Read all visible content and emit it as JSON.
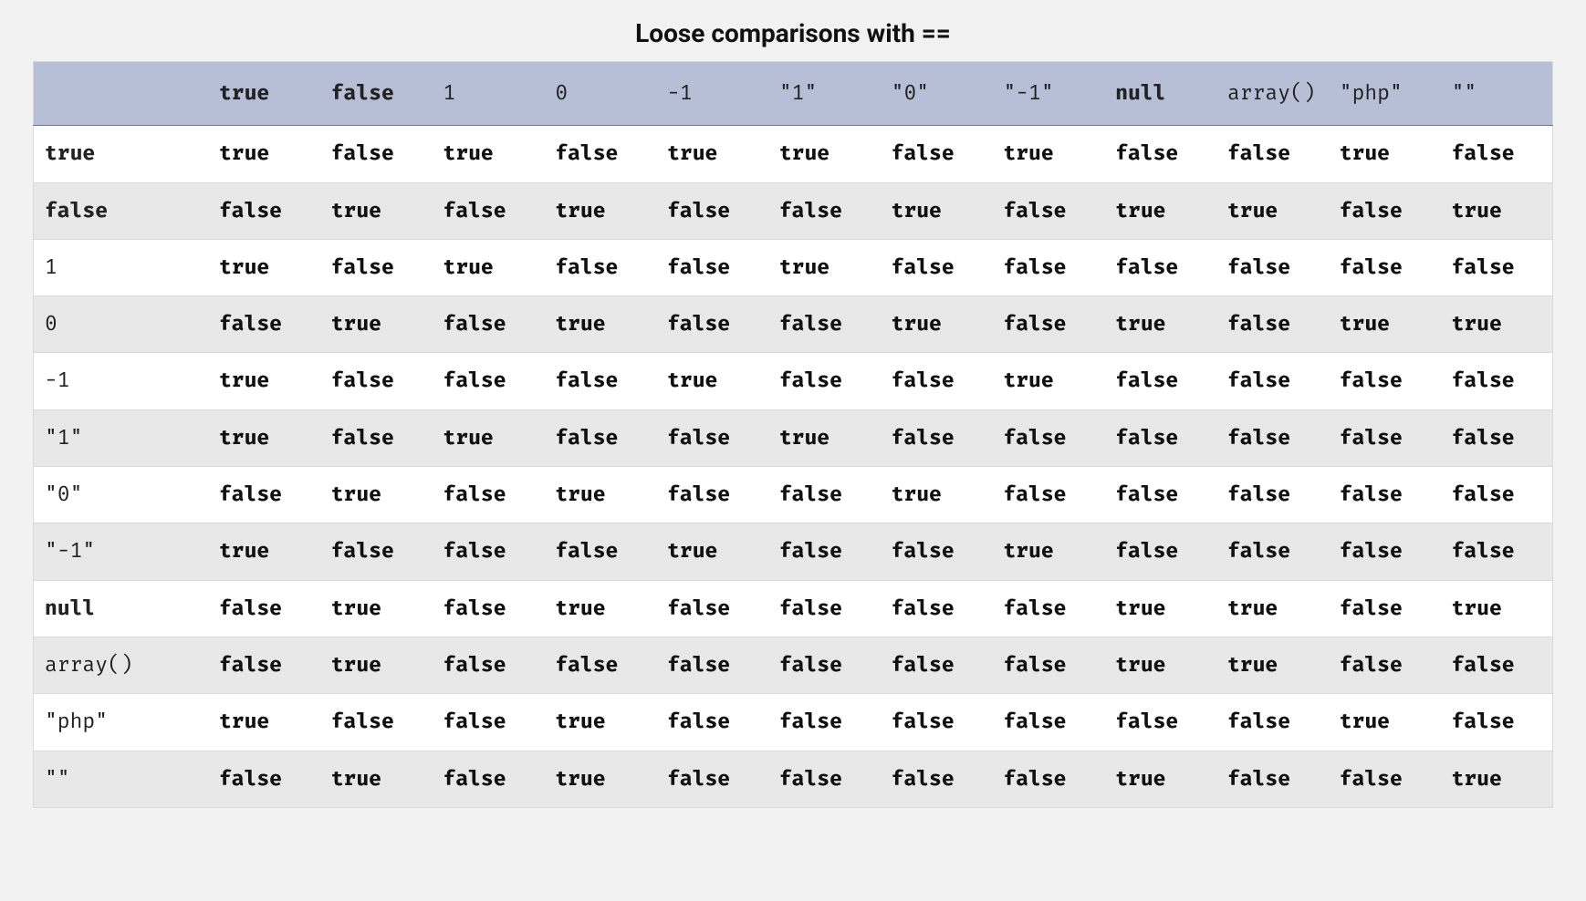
{
  "caption": "Loose comparisons with ==",
  "keywords": [
    "true",
    "false",
    "null"
  ],
  "columns": [
    "true",
    "false",
    "1",
    "0",
    "-1",
    "\"1\"",
    "\"0\"",
    "\"-1\"",
    "null",
    "array()",
    "\"php\"",
    "\"\""
  ],
  "rows": [
    {
      "label": "true",
      "cells": [
        "true",
        "false",
        "true",
        "false",
        "true",
        "true",
        "false",
        "true",
        "false",
        "false",
        "true",
        "false"
      ]
    },
    {
      "label": "false",
      "cells": [
        "false",
        "true",
        "false",
        "true",
        "false",
        "false",
        "true",
        "false",
        "true",
        "true",
        "false",
        "true"
      ]
    },
    {
      "label": "1",
      "cells": [
        "true",
        "false",
        "true",
        "false",
        "false",
        "true",
        "false",
        "false",
        "false",
        "false",
        "false",
        "false"
      ]
    },
    {
      "label": "0",
      "cells": [
        "false",
        "true",
        "false",
        "true",
        "false",
        "false",
        "true",
        "false",
        "true",
        "false",
        "true",
        "true"
      ]
    },
    {
      "label": "-1",
      "cells": [
        "true",
        "false",
        "false",
        "false",
        "true",
        "false",
        "false",
        "true",
        "false",
        "false",
        "false",
        "false"
      ]
    },
    {
      "label": "\"1\"",
      "cells": [
        "true",
        "false",
        "true",
        "false",
        "false",
        "true",
        "false",
        "false",
        "false",
        "false",
        "false",
        "false"
      ]
    },
    {
      "label": "\"0\"",
      "cells": [
        "false",
        "true",
        "false",
        "true",
        "false",
        "false",
        "true",
        "false",
        "false",
        "false",
        "false",
        "false"
      ]
    },
    {
      "label": "\"-1\"",
      "cells": [
        "true",
        "false",
        "false",
        "false",
        "true",
        "false",
        "false",
        "true",
        "false",
        "false",
        "false",
        "false"
      ]
    },
    {
      "label": "null",
      "cells": [
        "false",
        "true",
        "false",
        "true",
        "false",
        "false",
        "false",
        "false",
        "true",
        "true",
        "false",
        "true"
      ]
    },
    {
      "label": "array()",
      "cells": [
        "false",
        "true",
        "false",
        "false",
        "false",
        "false",
        "false",
        "false",
        "true",
        "true",
        "false",
        "false"
      ]
    },
    {
      "label": "\"php\"",
      "cells": [
        "true",
        "false",
        "false",
        "true",
        "false",
        "false",
        "false",
        "false",
        "false",
        "false",
        "true",
        "false"
      ]
    },
    {
      "label": "\"\"",
      "cells": [
        "false",
        "true",
        "false",
        "true",
        "false",
        "false",
        "false",
        "false",
        "true",
        "false",
        "false",
        "true"
      ]
    }
  ]
}
